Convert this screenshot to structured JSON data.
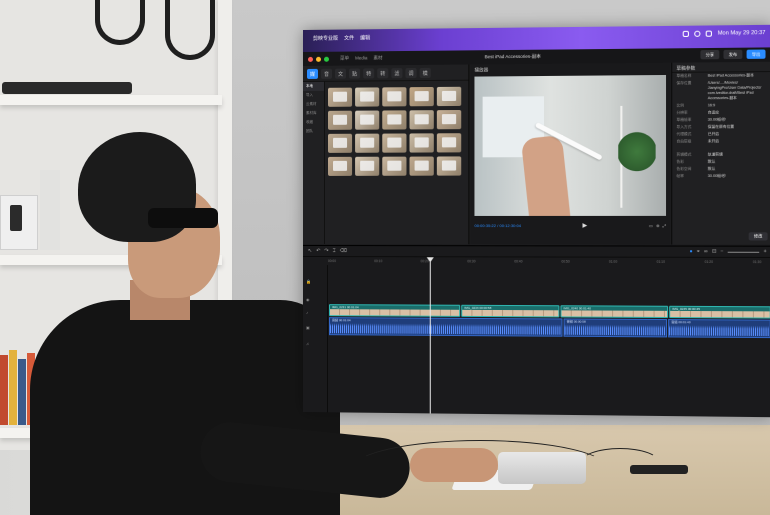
{
  "menubar": {
    "app_items": [
      "剪映专业版",
      "文件",
      "编辑"
    ],
    "datetime": "Mon May 29 20:37"
  },
  "app": {
    "menu": [
      "菜单",
      "Media",
      "素材"
    ],
    "project_title": "Best iPad Accessories-副本",
    "export_button": "导出",
    "share_button": "分享",
    "publish_button": "发布"
  },
  "media": {
    "toolbar": [
      "媒体",
      "音频",
      "文本",
      "贴纸",
      "特效",
      "转场",
      "滤镜",
      "调节",
      "模板"
    ],
    "sidebar": [
      "本地",
      "导入",
      "云素材",
      "素材库",
      "收藏",
      "团队"
    ],
    "thumbnails": [
      "#c7b39a",
      "#d7cdb9",
      "#c9b59c",
      "#c4a987",
      "#cfc2ac",
      "#b9a68d",
      "#d9cfbf",
      "#c2ad90",
      "#cdbfa9",
      "#c8b298",
      "#beab92",
      "#d2c4af",
      "#c7b49b",
      "#cbbda7",
      "#c5af94",
      "#c0aa90",
      "#d4c6b1",
      "#c9b7a0",
      "#bfa98e",
      "#cdbba3"
    ]
  },
  "preview": {
    "header": "播放器",
    "timecode": "00:00:35:22 / 00:12:30:04"
  },
  "inspector": {
    "header": "草稿参数",
    "rows": [
      {
        "key": "草稿名称",
        "value": "Best iPad Accessories-副本"
      },
      {
        "key": "保存位置",
        "value": "/Users/..../Movies/\nJianyingPro/User Data/Projects/\ncom.lveditor.draft/Best iPad\nAccessories-副本"
      },
      {
        "key": "比例",
        "value": "16:9"
      },
      {
        "key": "分辨率",
        "value": "自适应"
      },
      {
        "key": "草稿帧率",
        "value": "30.00帧/秒"
      },
      {
        "key": "导入方式",
        "value": "保留在原有位置"
      },
      {
        "key": "代理模式",
        "value": "已开启"
      },
      {
        "key": "自由层级",
        "value": "未开启"
      }
    ],
    "rows2": [
      {
        "key": "剪辑模式",
        "value": "轨道剪辑"
      },
      {
        "key": "色彩",
        "value": "默认"
      },
      {
        "key": "色彩空间",
        "value": "默认"
      },
      {
        "key": "帧率",
        "value": "30.00帧/秒"
      }
    ],
    "edit_button": "修改"
  },
  "timeline": {
    "ruler_marks": [
      "00:00",
      "00:10",
      "00:20",
      "00:30",
      "00:40",
      "00:50",
      "01:00",
      "01:10",
      "01:20",
      "01:30"
    ],
    "clips": [
      {
        "name": "IMG_0231 00:01:04",
        "start": 0,
        "width": 130
      },
      {
        "name": "IMG_0234 00:00:58",
        "start": 131,
        "width": 96
      },
      {
        "name": "IMG_0240 00:01:40",
        "start": 228,
        "width": 104
      },
      {
        "name": "IMG_0245 00:00:45",
        "start": 333,
        "width": 97
      }
    ],
    "audio": [
      {
        "name": "音频 00:01:04",
        "start": 0,
        "width": 230
      },
      {
        "name": "音频 00:00:58",
        "start": 231,
        "width": 100
      },
      {
        "name": "音频 00:01:40",
        "start": 332,
        "width": 98
      }
    ]
  }
}
